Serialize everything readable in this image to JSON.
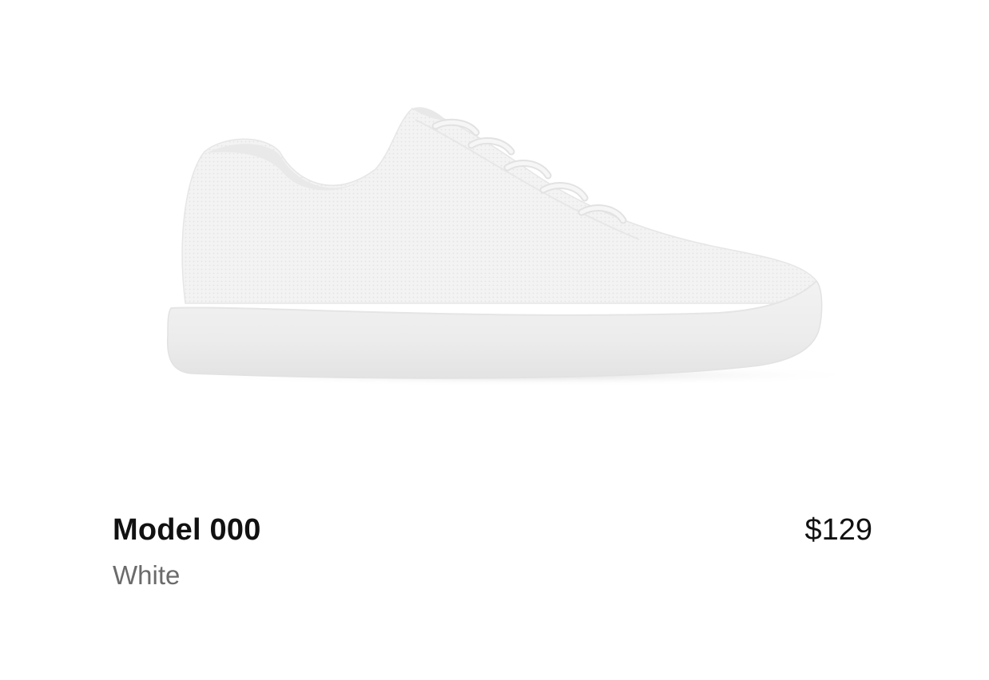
{
  "product": {
    "name": "Model 000",
    "color_name": "White",
    "price": "$129",
    "image_icon": "sneaker-image",
    "shoe_color": "#f1f1f1",
    "sole_color": "#efefef"
  }
}
